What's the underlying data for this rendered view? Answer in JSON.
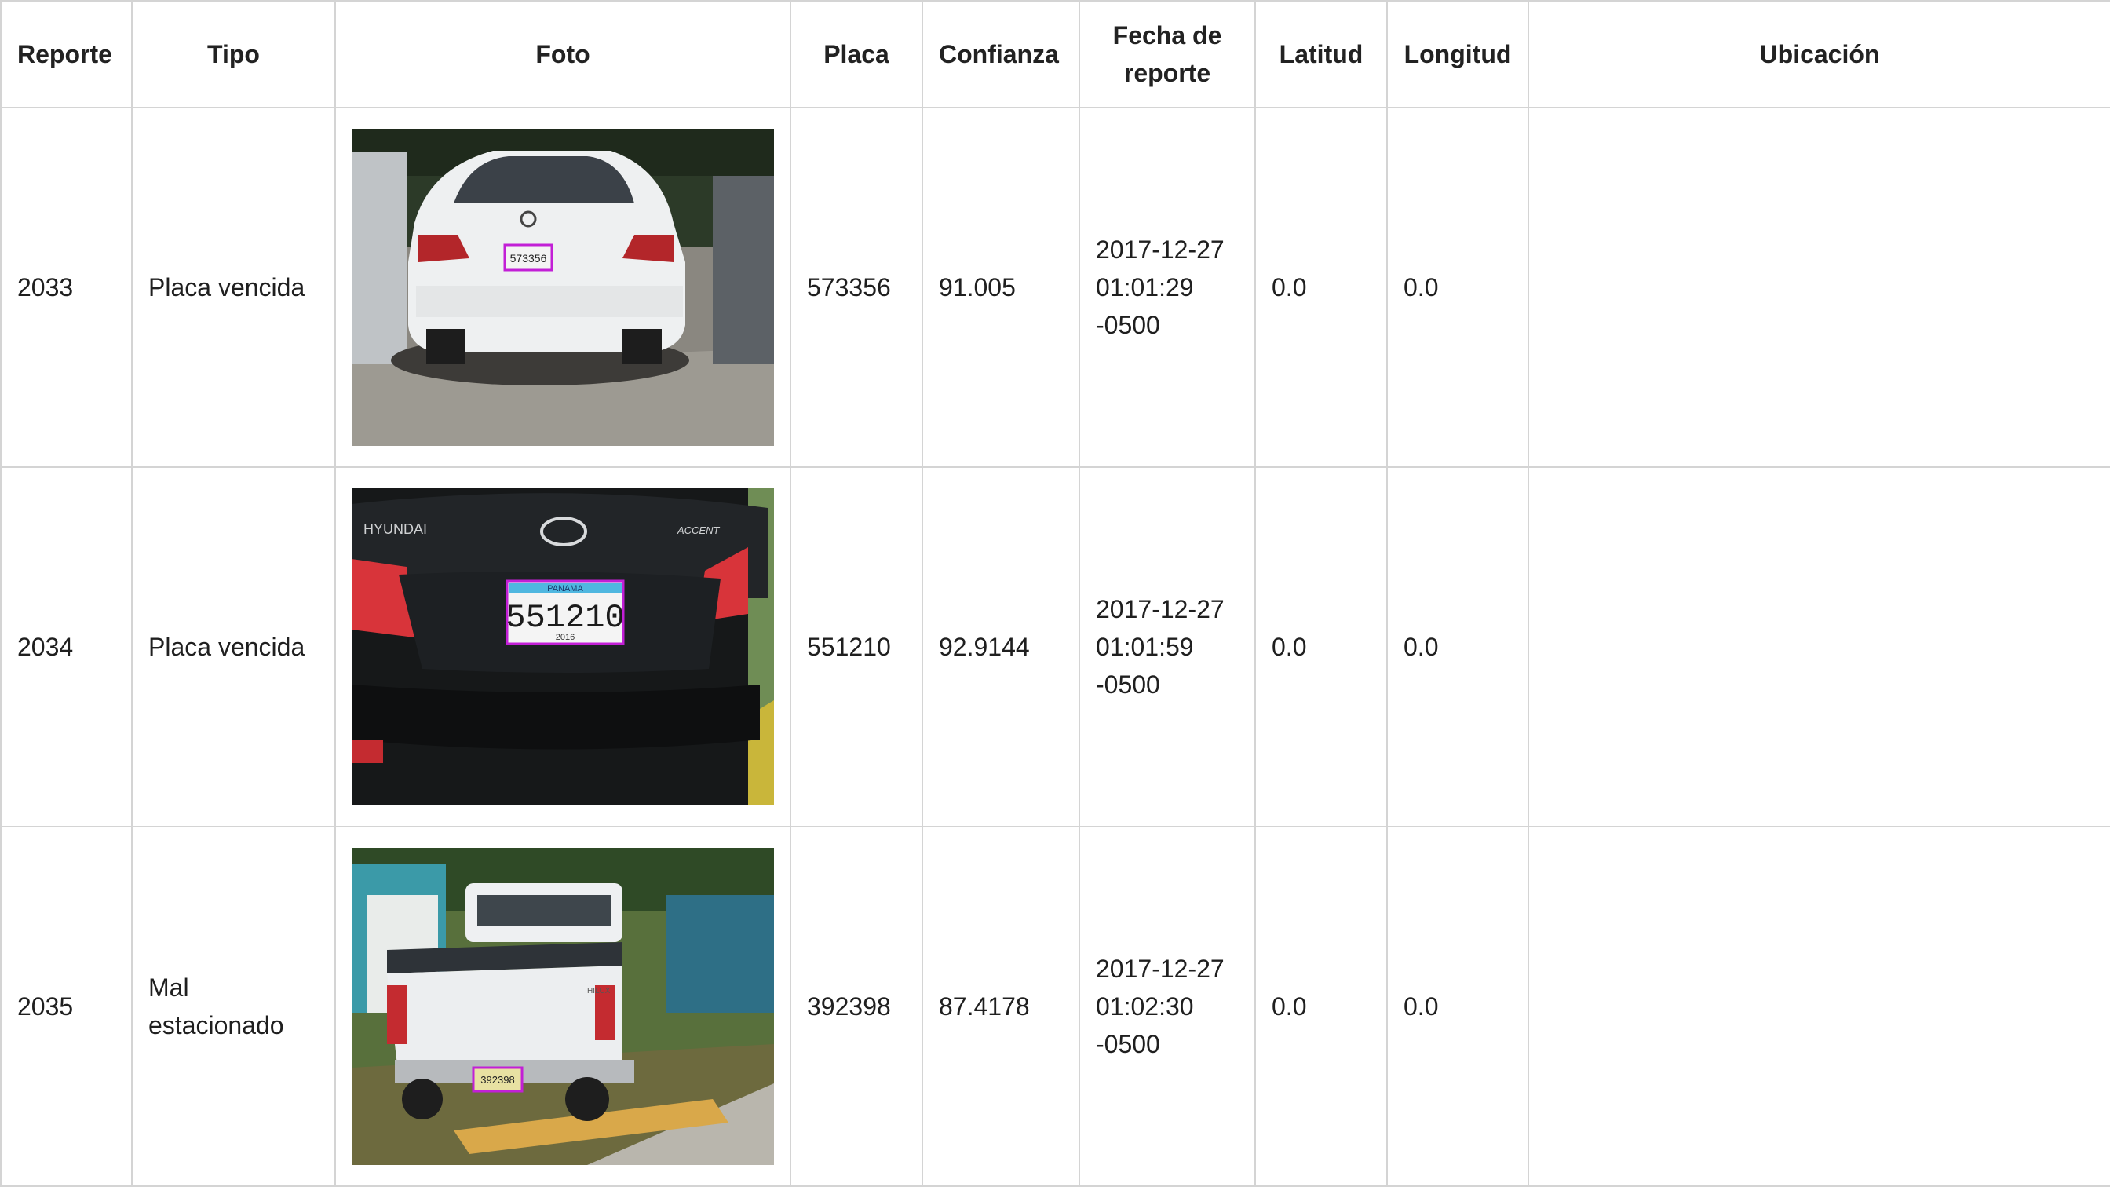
{
  "headers": {
    "reporte": "Reporte",
    "tipo": "Tipo",
    "foto": "Foto",
    "placa": "Placa",
    "confianza": "Confianza",
    "fecha_line1": "Fecha de",
    "fecha_line2": "reporte",
    "latitud": "Latitud",
    "longitud": "Longitud",
    "ubicacion": "Ubicación"
  },
  "rows": [
    {
      "reporte": "2033",
      "tipo": "Placa vencida",
      "placa": "573356",
      "confianza": "91.005",
      "fecha_1": "2017-12-27",
      "fecha_2": "01:01:29",
      "fecha_3": "-0500",
      "latitud": "0.0",
      "longitud": "0.0",
      "plate_text": "573356"
    },
    {
      "reporte": "2034",
      "tipo": "Placa vencida",
      "placa": "551210",
      "confianza": "92.9144",
      "fecha_1": "2017-12-27",
      "fecha_2": "01:01:59",
      "fecha_3": "-0500",
      "latitud": "0.0",
      "longitud": "0.0",
      "plate_text": "551210",
      "plate_header": "PANAMA",
      "plate_year": "2016",
      "brand": "HYUNDAI",
      "model": "ACCENT"
    },
    {
      "reporte": "2035",
      "tipo_1": "Mal",
      "tipo_2": "estacionado",
      "placa": "392398",
      "confianza": "87.4178",
      "fecha_1": "2017-12-27",
      "fecha_2": "01:02:30",
      "fecha_3": "-0500",
      "latitud": "0.0",
      "longitud": "0.0",
      "plate_text": "392398",
      "model": "HILUX"
    }
  ],
  "colors": {
    "border": "#d4d4d4",
    "detection_box": "#c21fd6",
    "text": "#1f1f1f"
  }
}
